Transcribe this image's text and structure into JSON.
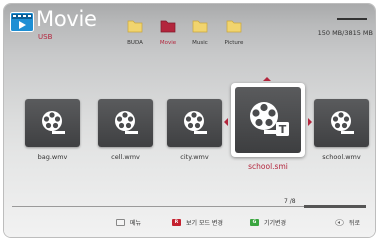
{
  "header": {
    "title": "Movie",
    "subtitle": "USB",
    "folders": [
      {
        "label": "BUDA"
      },
      {
        "label": "Movie"
      },
      {
        "label": "Music"
      },
      {
        "label": "Picture"
      }
    ],
    "storage": "150 MB/3815 MB"
  },
  "files": {
    "items": [
      {
        "label": "bag.wmv"
      },
      {
        "label": "cell.wmv"
      },
      {
        "label": "city.wmv"
      },
      {
        "label": "school.smi"
      },
      {
        "label": "school.wmv"
      }
    ]
  },
  "pagination": "7 /8",
  "footer": {
    "hints": [
      {
        "key": "",
        "label": "메뉴"
      },
      {
        "key": "R",
        "label": "보기 모드 변경"
      },
      {
        "key": "G",
        "label": "기기변경"
      },
      {
        "key": "",
        "label": "뒤로"
      }
    ]
  },
  "colors": {
    "accent": "#b3263d",
    "folder_active": "#b3263d",
    "folder": "#f1d46e",
    "red_key": "#c4212f",
    "green_key": "#3aa640"
  }
}
